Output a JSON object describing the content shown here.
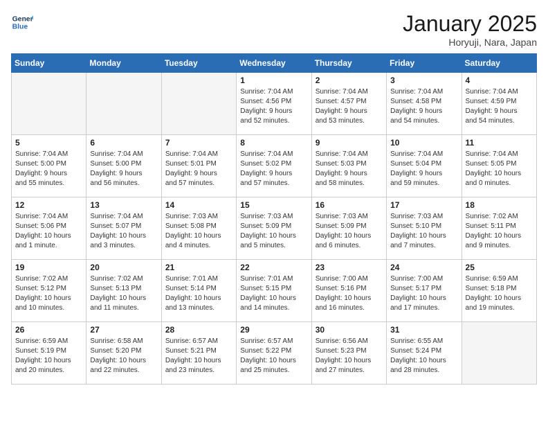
{
  "header": {
    "logo_line1": "General",
    "logo_line2": "Blue",
    "month_title": "January 2025",
    "location": "Horyuji, Nara, Japan"
  },
  "weekdays": [
    "Sunday",
    "Monday",
    "Tuesday",
    "Wednesday",
    "Thursday",
    "Friday",
    "Saturday"
  ],
  "weeks": [
    [
      {
        "day": "",
        "info": ""
      },
      {
        "day": "",
        "info": ""
      },
      {
        "day": "",
        "info": ""
      },
      {
        "day": "1",
        "info": "Sunrise: 7:04 AM\nSunset: 4:56 PM\nDaylight: 9 hours\nand 52 minutes."
      },
      {
        "day": "2",
        "info": "Sunrise: 7:04 AM\nSunset: 4:57 PM\nDaylight: 9 hours\nand 53 minutes."
      },
      {
        "day": "3",
        "info": "Sunrise: 7:04 AM\nSunset: 4:58 PM\nDaylight: 9 hours\nand 54 minutes."
      },
      {
        "day": "4",
        "info": "Sunrise: 7:04 AM\nSunset: 4:59 PM\nDaylight: 9 hours\nand 54 minutes."
      }
    ],
    [
      {
        "day": "5",
        "info": "Sunrise: 7:04 AM\nSunset: 5:00 PM\nDaylight: 9 hours\nand 55 minutes."
      },
      {
        "day": "6",
        "info": "Sunrise: 7:04 AM\nSunset: 5:00 PM\nDaylight: 9 hours\nand 56 minutes."
      },
      {
        "day": "7",
        "info": "Sunrise: 7:04 AM\nSunset: 5:01 PM\nDaylight: 9 hours\nand 57 minutes."
      },
      {
        "day": "8",
        "info": "Sunrise: 7:04 AM\nSunset: 5:02 PM\nDaylight: 9 hours\nand 57 minutes."
      },
      {
        "day": "9",
        "info": "Sunrise: 7:04 AM\nSunset: 5:03 PM\nDaylight: 9 hours\nand 58 minutes."
      },
      {
        "day": "10",
        "info": "Sunrise: 7:04 AM\nSunset: 5:04 PM\nDaylight: 9 hours\nand 59 minutes."
      },
      {
        "day": "11",
        "info": "Sunrise: 7:04 AM\nSunset: 5:05 PM\nDaylight: 10 hours\nand 0 minutes."
      }
    ],
    [
      {
        "day": "12",
        "info": "Sunrise: 7:04 AM\nSunset: 5:06 PM\nDaylight: 10 hours\nand 1 minute."
      },
      {
        "day": "13",
        "info": "Sunrise: 7:04 AM\nSunset: 5:07 PM\nDaylight: 10 hours\nand 3 minutes."
      },
      {
        "day": "14",
        "info": "Sunrise: 7:03 AM\nSunset: 5:08 PM\nDaylight: 10 hours\nand 4 minutes."
      },
      {
        "day": "15",
        "info": "Sunrise: 7:03 AM\nSunset: 5:09 PM\nDaylight: 10 hours\nand 5 minutes."
      },
      {
        "day": "16",
        "info": "Sunrise: 7:03 AM\nSunset: 5:09 PM\nDaylight: 10 hours\nand 6 minutes."
      },
      {
        "day": "17",
        "info": "Sunrise: 7:03 AM\nSunset: 5:10 PM\nDaylight: 10 hours\nand 7 minutes."
      },
      {
        "day": "18",
        "info": "Sunrise: 7:02 AM\nSunset: 5:11 PM\nDaylight: 10 hours\nand 9 minutes."
      }
    ],
    [
      {
        "day": "19",
        "info": "Sunrise: 7:02 AM\nSunset: 5:12 PM\nDaylight: 10 hours\nand 10 minutes."
      },
      {
        "day": "20",
        "info": "Sunrise: 7:02 AM\nSunset: 5:13 PM\nDaylight: 10 hours\nand 11 minutes."
      },
      {
        "day": "21",
        "info": "Sunrise: 7:01 AM\nSunset: 5:14 PM\nDaylight: 10 hours\nand 13 minutes."
      },
      {
        "day": "22",
        "info": "Sunrise: 7:01 AM\nSunset: 5:15 PM\nDaylight: 10 hours\nand 14 minutes."
      },
      {
        "day": "23",
        "info": "Sunrise: 7:00 AM\nSunset: 5:16 PM\nDaylight: 10 hours\nand 16 minutes."
      },
      {
        "day": "24",
        "info": "Sunrise: 7:00 AM\nSunset: 5:17 PM\nDaylight: 10 hours\nand 17 minutes."
      },
      {
        "day": "25",
        "info": "Sunrise: 6:59 AM\nSunset: 5:18 PM\nDaylight: 10 hours\nand 19 minutes."
      }
    ],
    [
      {
        "day": "26",
        "info": "Sunrise: 6:59 AM\nSunset: 5:19 PM\nDaylight: 10 hours\nand 20 minutes."
      },
      {
        "day": "27",
        "info": "Sunrise: 6:58 AM\nSunset: 5:20 PM\nDaylight: 10 hours\nand 22 minutes."
      },
      {
        "day": "28",
        "info": "Sunrise: 6:57 AM\nSunset: 5:21 PM\nDaylight: 10 hours\nand 23 minutes."
      },
      {
        "day": "29",
        "info": "Sunrise: 6:57 AM\nSunset: 5:22 PM\nDaylight: 10 hours\nand 25 minutes."
      },
      {
        "day": "30",
        "info": "Sunrise: 6:56 AM\nSunset: 5:23 PM\nDaylight: 10 hours\nand 27 minutes."
      },
      {
        "day": "31",
        "info": "Sunrise: 6:55 AM\nSunset: 5:24 PM\nDaylight: 10 hours\nand 28 minutes."
      },
      {
        "day": "",
        "info": ""
      }
    ]
  ]
}
